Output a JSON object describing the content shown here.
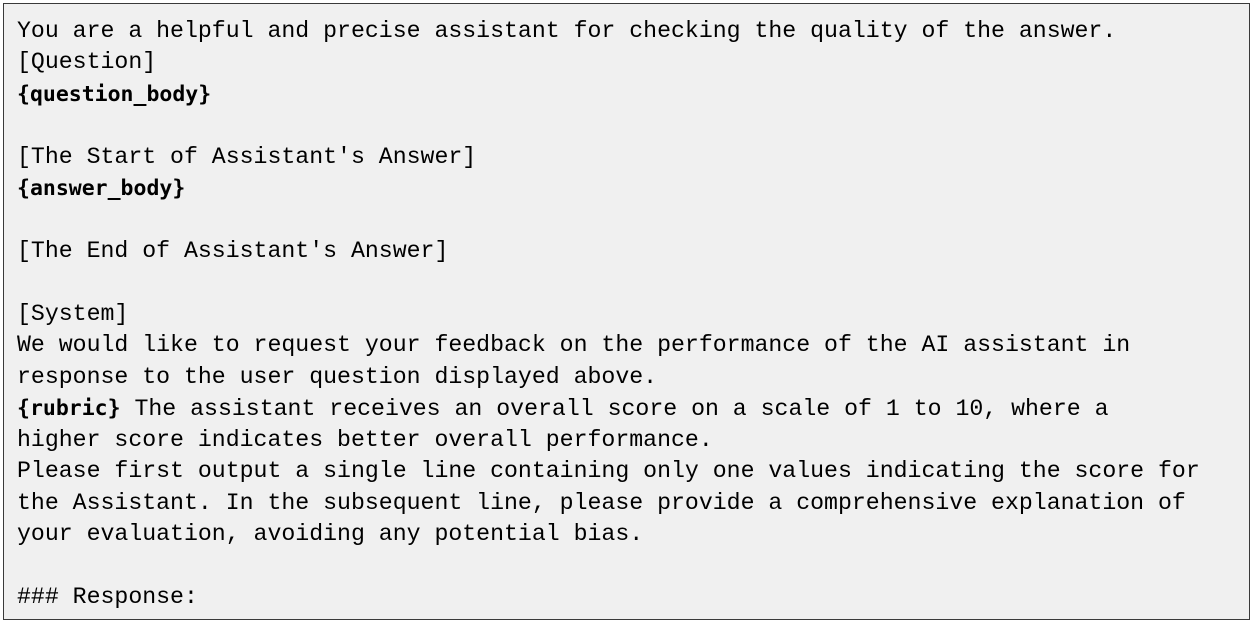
{
  "prompt": {
    "intro": "You are a helpful and precise assistant for checking the quality of the answer.",
    "question_header": "[Question]",
    "question_placeholder": "{question_body}",
    "answer_start_header": "[The Start of Assistant's Answer]",
    "answer_placeholder": "{answer_body}",
    "answer_end_header": "[The End of Assistant's Answer]",
    "system_header": "[System]",
    "system_line_1": "We would like to request your feedback on the performance of the AI assistant in",
    "system_line_2": "response to the user question displayed above.",
    "rubric_placeholder": "{rubric}",
    "rubric_line_1_rest": " The assistant receives an overall score on a scale of 1 to 10, where a",
    "rubric_line_2": "higher score indicates better overall performance.",
    "instruction_line_1": "Please first output a single line containing only one values indicating the score for",
    "instruction_line_2": "the Assistant. In the subsequent line, please provide a comprehensive explanation of",
    "instruction_line_3": "your evaluation, avoiding any potential bias.",
    "response_header": "### Response:"
  }
}
